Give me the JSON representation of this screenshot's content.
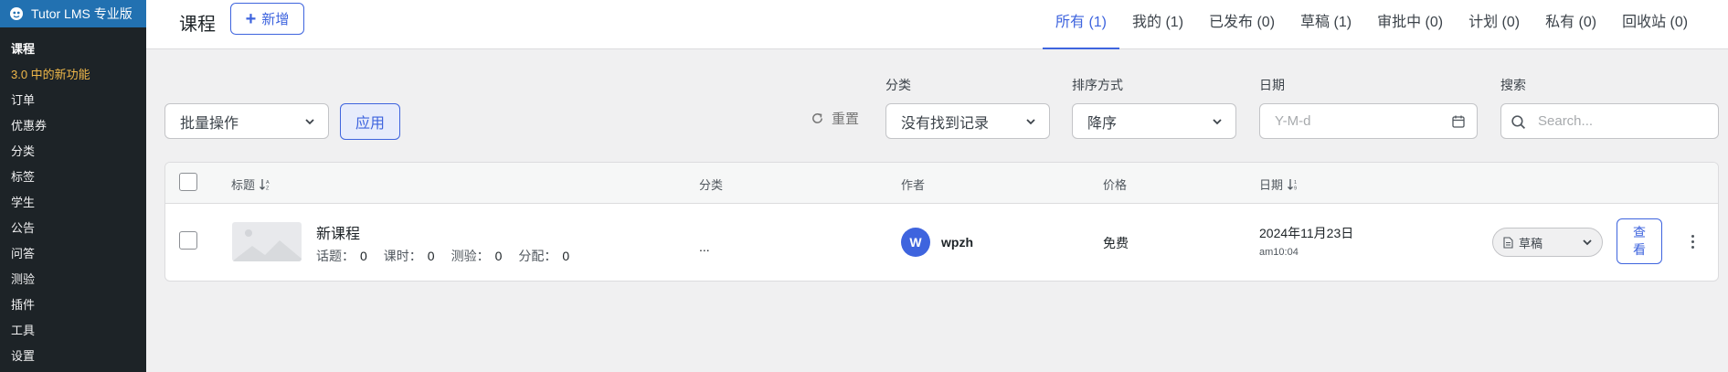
{
  "sidebar": {
    "brand": "Tutor LMS 专业版",
    "items": [
      {
        "label": "课程",
        "state": "active"
      },
      {
        "label": "3.0 中的新功能",
        "state": "new"
      },
      {
        "label": "订单",
        "state": ""
      },
      {
        "label": "优惠券",
        "state": ""
      },
      {
        "label": "分类",
        "state": ""
      },
      {
        "label": "标签",
        "state": ""
      },
      {
        "label": "学生",
        "state": ""
      },
      {
        "label": "公告",
        "state": ""
      },
      {
        "label": "问答",
        "state": ""
      },
      {
        "label": "测验",
        "state": ""
      },
      {
        "label": "插件",
        "state": ""
      },
      {
        "label": "工具",
        "state": ""
      },
      {
        "label": "设置",
        "state": ""
      }
    ]
  },
  "header": {
    "title": "课程",
    "add_label": "新增",
    "tabs": [
      {
        "label": "所有 (1)",
        "active": true
      },
      {
        "label": "我的 (1)",
        "active": false
      },
      {
        "label": "已发布 (0)",
        "active": false
      },
      {
        "label": "草稿 (1)",
        "active": false
      },
      {
        "label": "审批中 (0)",
        "active": false
      },
      {
        "label": "计划 (0)",
        "active": false
      },
      {
        "label": "私有 (0)",
        "active": false
      },
      {
        "label": "回收站 (0)",
        "active": false
      }
    ]
  },
  "filters": {
    "bulk_action": "批量操作",
    "apply_label": "应用",
    "reset_label": "重置",
    "category_label": "分类",
    "category_value": "没有找到记录",
    "sort_label": "排序方式",
    "sort_value": "降序",
    "date_label": "日期",
    "date_placeholder": "Y-M-d",
    "search_label": "搜索",
    "search_placeholder": "Search..."
  },
  "table": {
    "columns": {
      "title": "标题",
      "category": "分类",
      "author": "作者",
      "price": "价格",
      "date": "日期"
    },
    "rows": [
      {
        "title": "新课程",
        "meta": [
          {
            "label": "话题：",
            "value": "0"
          },
          {
            "label": "课时：",
            "value": "0"
          },
          {
            "label": "测验：",
            "value": "0"
          },
          {
            "label": "分配：",
            "value": "0"
          }
        ],
        "category": "...",
        "author_initial": "W",
        "author": "wpzh",
        "price": "免费",
        "date": "2024年11月23日",
        "time": "am10:04",
        "status": "草稿",
        "view_label": "查看"
      }
    ]
  },
  "colors": {
    "accent": "#3e64de",
    "sidebar_bg": "#1d2327",
    "sidebar_head": "#2271b1",
    "highlight": "#f0b849"
  }
}
